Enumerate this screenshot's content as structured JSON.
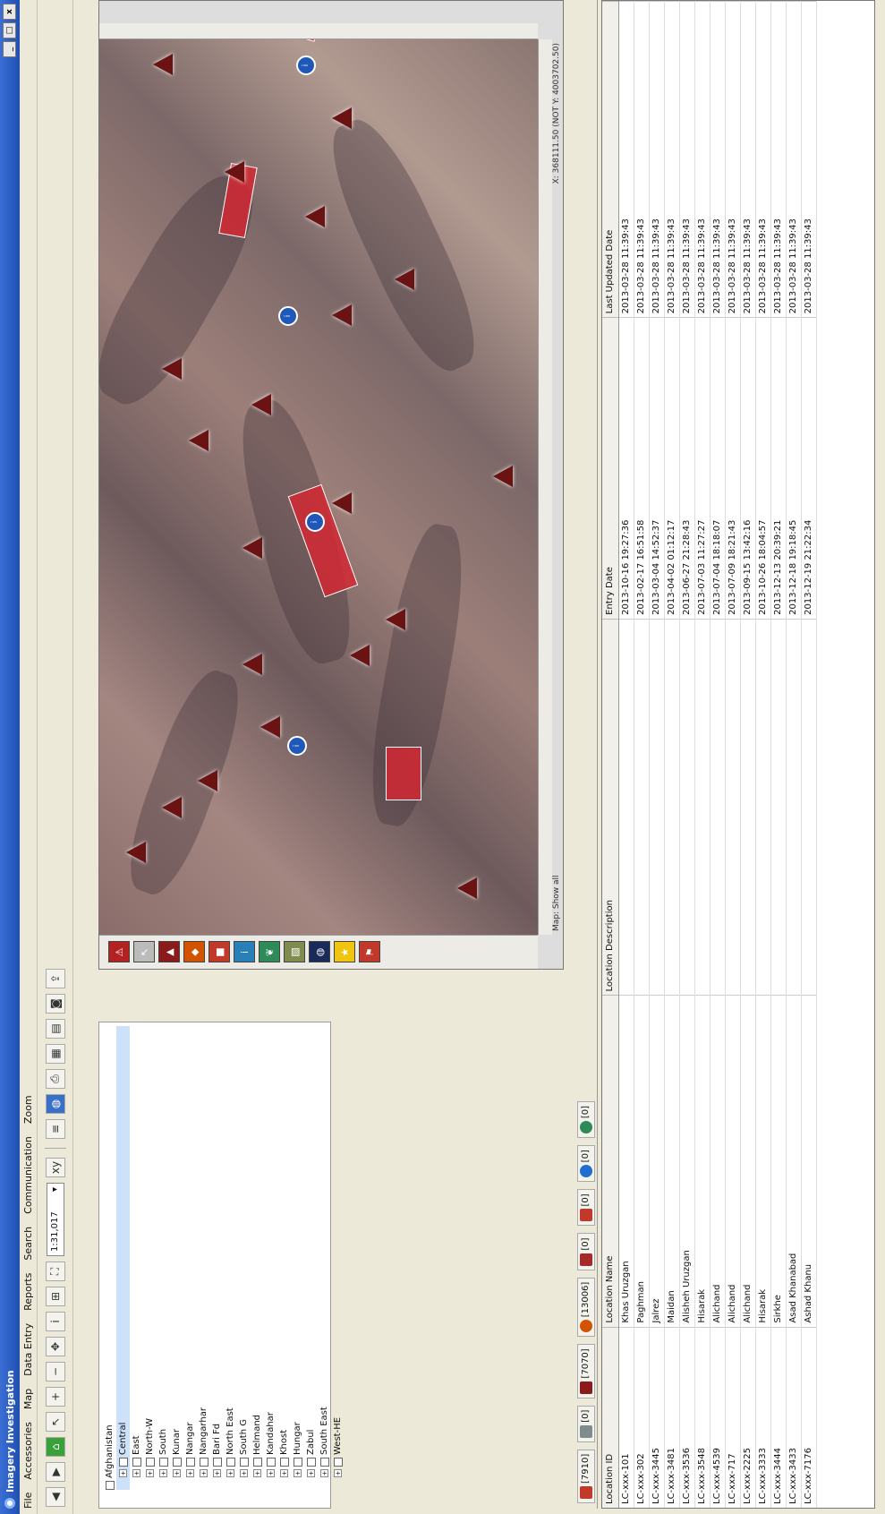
{
  "window": {
    "title": "Imagery Investigation"
  },
  "menu": [
    "File",
    "Accessories",
    "Map",
    "Data Entry",
    "Reports",
    "Search",
    "Communication",
    "Zoom"
  ],
  "toolbar": {
    "zoom_value": "1:31,017"
  },
  "tree": {
    "root": "Afghanistan",
    "items": [
      {
        "label": "Central",
        "selected": true
      },
      {
        "label": "East"
      },
      {
        "label": "North-W"
      },
      {
        "label": "South"
      },
      {
        "label": "Kunar"
      },
      {
        "label": "Nangar"
      },
      {
        "label": "Nangarhar"
      },
      {
        "label": "Bari Fd"
      },
      {
        "label": "North East"
      },
      {
        "label": "South G"
      },
      {
        "label": "Helmand"
      },
      {
        "label": "Kandahar"
      },
      {
        "label": "Khost"
      },
      {
        "label": "Hungar"
      },
      {
        "label": "Zabul"
      },
      {
        "label": "South East"
      },
      {
        "label": "West-HE"
      }
    ]
  },
  "map": {
    "status_left": "Map: Show all",
    "status_right": "X: 368111.50 (NOT Y: 4003702.50)"
  },
  "bottom_tabs": [
    {
      "label": "[7910]",
      "color": "#c0392b"
    },
    {
      "label": "[0]",
      "color": "#7f8c8d"
    },
    {
      "label": "[7070]",
      "color": "#8b1a1a"
    },
    {
      "label": "[13006]",
      "color": "#d35400"
    },
    {
      "label": "[0]",
      "color": "#a52a2a"
    },
    {
      "label": "[0]",
      "color": "#c0392b"
    },
    {
      "label": "[0]",
      "color": "#1f6fd0"
    },
    {
      "label": "[0]",
      "color": "#2e8b57"
    }
  ],
  "grid": {
    "columns": [
      "Location ID",
      "Location Name",
      "Location Description",
      "Entry Date",
      "Last Updated Date"
    ],
    "rows": [
      [
        "LC-xxx-101",
        "Khas Uruzgan",
        "",
        "2013-10-16 19:27:36",
        "2013-03-28 11:39:43"
      ],
      [
        "LC-xxx-302",
        "Paghman",
        "",
        "2013-02-17 16:51:58",
        "2013-03-28 11:39:43"
      ],
      [
        "LC-xxx-3445",
        "Jalrez",
        "",
        "2013-03-04 14:52:37",
        "2013-03-28 11:39:43"
      ],
      [
        "LC-xxx-3481",
        "Maidan",
        "",
        "2013-04-02 01:12:17",
        "2013-03-28 11:39:43"
      ],
      [
        "LC-xxx-3536",
        "Alisheh Uruzgan",
        "",
        "2013-06-27 21:28:43",
        "2013-03-28 11:39:43"
      ],
      [
        "LC-xxx-3548",
        "Hisarak",
        "",
        "2013-07-03 11:27:27",
        "2013-03-28 11:39:43"
      ],
      [
        "LC-xxx-4539",
        "Alichand",
        "",
        "2013-07-04 18:18:07",
        "2013-03-28 11:39:43"
      ],
      [
        "LC-xxx-717",
        "Alichand",
        "",
        "2013-07-09 18:21:43",
        "2013-03-28 11:39:43"
      ],
      [
        "LC-xxx-2225",
        "Alichand",
        "",
        "2013-09-15 13:42:16",
        "2013-03-28 11:39:43"
      ],
      [
        "LC-xxx-3333",
        "Hisarak",
        "",
        "2013-10-26 18:04:57",
        "2013-03-28 11:39:43"
      ],
      [
        "LC-xxx-3444",
        "Sirkhe",
        "",
        "2013-12-13 20:39:21",
        "2013-03-28 11:39:43"
      ],
      [
        "LC-xxx-3433",
        "Asad Khanabad",
        "",
        "2013-12-18 19:18:45",
        "2013-03-28 11:39:43"
      ],
      [
        "LC-xxx-7176",
        "Ashad Khanu",
        "",
        "2013-12-19 21:22:34",
        "2013-03-28 11:39:43"
      ]
    ]
  },
  "icons": {
    "palette": [
      "warning-icon",
      "pointer-icon",
      "marker-icon",
      "area-icon",
      "square-icon",
      "info-icon",
      "leaf-icon",
      "map-icon",
      "globe-icon",
      "star-icon",
      "flag-icon"
    ]
  }
}
